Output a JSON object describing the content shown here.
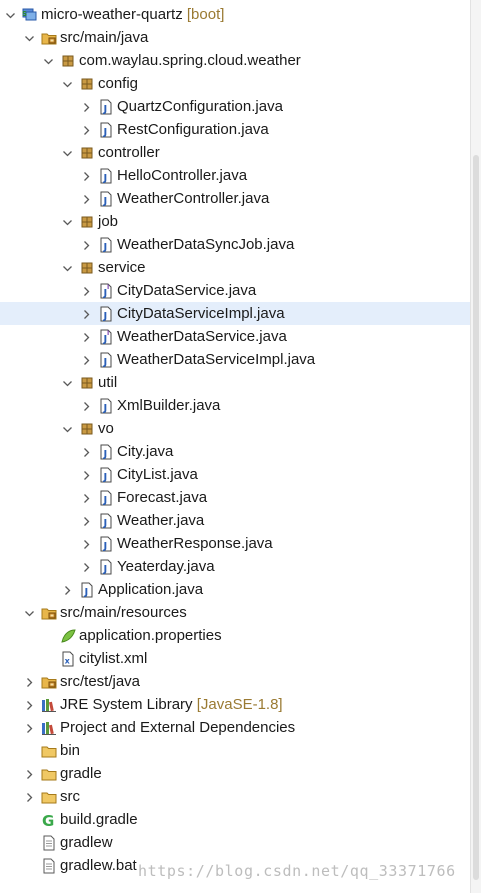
{
  "watermark": "https://blog.csdn.net/qq_33371766",
  "tree": [
    {
      "depth": 0,
      "twisty": "down",
      "icon": "project",
      "label": "micro-weather-quartz",
      "decoration": "[boot]"
    },
    {
      "depth": 1,
      "twisty": "down",
      "icon": "source-folder",
      "label": "src/main/java"
    },
    {
      "depth": 2,
      "twisty": "down",
      "icon": "package",
      "label": "com.waylau.spring.cloud.weather"
    },
    {
      "depth": 3,
      "twisty": "down",
      "icon": "package",
      "label": "config"
    },
    {
      "depth": 4,
      "twisty": "right",
      "icon": "java-class",
      "label": "QuartzConfiguration.java"
    },
    {
      "depth": 4,
      "twisty": "right",
      "icon": "java-class",
      "label": "RestConfiguration.java"
    },
    {
      "depth": 3,
      "twisty": "down",
      "icon": "package",
      "label": "controller"
    },
    {
      "depth": 4,
      "twisty": "right",
      "icon": "java-class",
      "label": "HelloController.java"
    },
    {
      "depth": 4,
      "twisty": "right",
      "icon": "java-class",
      "label": "WeatherController.java"
    },
    {
      "depth": 3,
      "twisty": "down",
      "icon": "package",
      "label": "job"
    },
    {
      "depth": 4,
      "twisty": "right",
      "icon": "java-class",
      "label": "WeatherDataSyncJob.java"
    },
    {
      "depth": 3,
      "twisty": "down",
      "icon": "package",
      "label": "service"
    },
    {
      "depth": 4,
      "twisty": "right",
      "icon": "java-interface",
      "label": "CityDataService.java"
    },
    {
      "depth": 4,
      "twisty": "right",
      "icon": "java-class",
      "label": "CityDataServiceImpl.java",
      "selected": true
    },
    {
      "depth": 4,
      "twisty": "right",
      "icon": "java-interface",
      "label": "WeatherDataService.java"
    },
    {
      "depth": 4,
      "twisty": "right",
      "icon": "java-class",
      "label": "WeatherDataServiceImpl.java"
    },
    {
      "depth": 3,
      "twisty": "down",
      "icon": "package",
      "label": "util"
    },
    {
      "depth": 4,
      "twisty": "right",
      "icon": "java-class",
      "label": "XmlBuilder.java"
    },
    {
      "depth": 3,
      "twisty": "down",
      "icon": "package",
      "label": "vo"
    },
    {
      "depth": 4,
      "twisty": "right",
      "icon": "java-class",
      "label": "City.java"
    },
    {
      "depth": 4,
      "twisty": "right",
      "icon": "java-class",
      "label": "CityList.java"
    },
    {
      "depth": 4,
      "twisty": "right",
      "icon": "java-class",
      "label": "Forecast.java"
    },
    {
      "depth": 4,
      "twisty": "right",
      "icon": "java-class",
      "label": "Weather.java"
    },
    {
      "depth": 4,
      "twisty": "right",
      "icon": "java-class",
      "label": "WeatherResponse.java"
    },
    {
      "depth": 4,
      "twisty": "right",
      "icon": "java-class",
      "label": "Yeaterday.java"
    },
    {
      "depth": 3,
      "twisty": "right",
      "icon": "java-class",
      "label": "Application.java"
    },
    {
      "depth": 1,
      "twisty": "down",
      "icon": "source-folder",
      "label": "src/main/resources"
    },
    {
      "depth": 2,
      "twisty": "none",
      "icon": "properties-file",
      "label": "application.properties"
    },
    {
      "depth": 2,
      "twisty": "none",
      "icon": "xml-file",
      "label": "citylist.xml"
    },
    {
      "depth": 1,
      "twisty": "right",
      "icon": "source-folder",
      "label": "src/test/java"
    },
    {
      "depth": 1,
      "twisty": "right",
      "icon": "library",
      "label": "JRE System Library",
      "decoration": "[JavaSE-1.8]"
    },
    {
      "depth": 1,
      "twisty": "right",
      "icon": "library",
      "label": "Project and External Dependencies"
    },
    {
      "depth": 1,
      "twisty": "none",
      "icon": "folder",
      "label": "bin"
    },
    {
      "depth": 1,
      "twisty": "right",
      "icon": "folder",
      "label": "gradle"
    },
    {
      "depth": 1,
      "twisty": "right",
      "icon": "folder",
      "label": "src"
    },
    {
      "depth": 1,
      "twisty": "none",
      "icon": "gradle-file",
      "label": "build.gradle"
    },
    {
      "depth": 1,
      "twisty": "none",
      "icon": "text-file",
      "label": "gradlew"
    },
    {
      "depth": 1,
      "twisty": "none",
      "icon": "text-file",
      "label": "gradlew.bat"
    }
  ]
}
